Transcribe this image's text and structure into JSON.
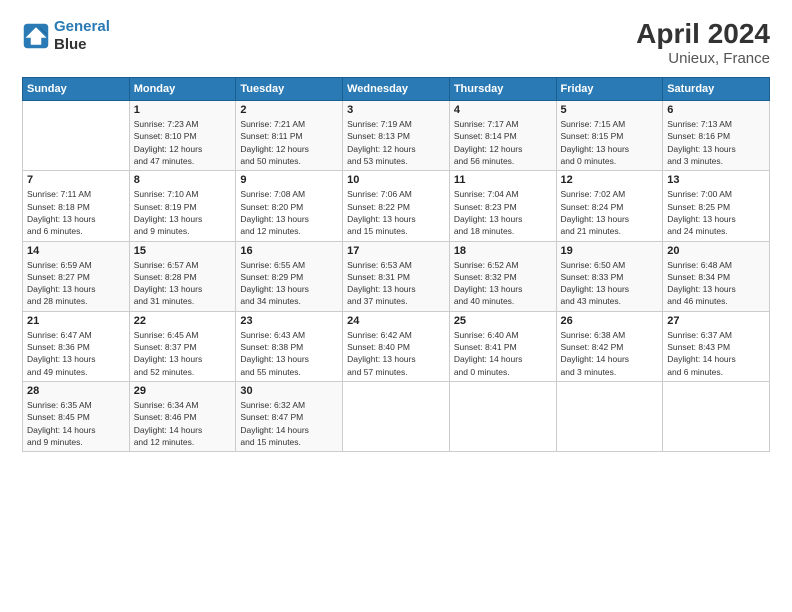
{
  "header": {
    "logo_line1": "General",
    "logo_line2": "Blue",
    "title": "April 2024",
    "subtitle": "Unieux, France"
  },
  "days_of_week": [
    "Sunday",
    "Monday",
    "Tuesday",
    "Wednesday",
    "Thursday",
    "Friday",
    "Saturday"
  ],
  "weeks": [
    [
      {
        "day": "",
        "info": ""
      },
      {
        "day": "1",
        "info": "Sunrise: 7:23 AM\nSunset: 8:10 PM\nDaylight: 12 hours\nand 47 minutes."
      },
      {
        "day": "2",
        "info": "Sunrise: 7:21 AM\nSunset: 8:11 PM\nDaylight: 12 hours\nand 50 minutes."
      },
      {
        "day": "3",
        "info": "Sunrise: 7:19 AM\nSunset: 8:13 PM\nDaylight: 12 hours\nand 53 minutes."
      },
      {
        "day": "4",
        "info": "Sunrise: 7:17 AM\nSunset: 8:14 PM\nDaylight: 12 hours\nand 56 minutes."
      },
      {
        "day": "5",
        "info": "Sunrise: 7:15 AM\nSunset: 8:15 PM\nDaylight: 13 hours\nand 0 minutes."
      },
      {
        "day": "6",
        "info": "Sunrise: 7:13 AM\nSunset: 8:16 PM\nDaylight: 13 hours\nand 3 minutes."
      }
    ],
    [
      {
        "day": "7",
        "info": "Sunrise: 7:11 AM\nSunset: 8:18 PM\nDaylight: 13 hours\nand 6 minutes."
      },
      {
        "day": "8",
        "info": "Sunrise: 7:10 AM\nSunset: 8:19 PM\nDaylight: 13 hours\nand 9 minutes."
      },
      {
        "day": "9",
        "info": "Sunrise: 7:08 AM\nSunset: 8:20 PM\nDaylight: 13 hours\nand 12 minutes."
      },
      {
        "day": "10",
        "info": "Sunrise: 7:06 AM\nSunset: 8:22 PM\nDaylight: 13 hours\nand 15 minutes."
      },
      {
        "day": "11",
        "info": "Sunrise: 7:04 AM\nSunset: 8:23 PM\nDaylight: 13 hours\nand 18 minutes."
      },
      {
        "day": "12",
        "info": "Sunrise: 7:02 AM\nSunset: 8:24 PM\nDaylight: 13 hours\nand 21 minutes."
      },
      {
        "day": "13",
        "info": "Sunrise: 7:00 AM\nSunset: 8:25 PM\nDaylight: 13 hours\nand 24 minutes."
      }
    ],
    [
      {
        "day": "14",
        "info": "Sunrise: 6:59 AM\nSunset: 8:27 PM\nDaylight: 13 hours\nand 28 minutes."
      },
      {
        "day": "15",
        "info": "Sunrise: 6:57 AM\nSunset: 8:28 PM\nDaylight: 13 hours\nand 31 minutes."
      },
      {
        "day": "16",
        "info": "Sunrise: 6:55 AM\nSunset: 8:29 PM\nDaylight: 13 hours\nand 34 minutes."
      },
      {
        "day": "17",
        "info": "Sunrise: 6:53 AM\nSunset: 8:31 PM\nDaylight: 13 hours\nand 37 minutes."
      },
      {
        "day": "18",
        "info": "Sunrise: 6:52 AM\nSunset: 8:32 PM\nDaylight: 13 hours\nand 40 minutes."
      },
      {
        "day": "19",
        "info": "Sunrise: 6:50 AM\nSunset: 8:33 PM\nDaylight: 13 hours\nand 43 minutes."
      },
      {
        "day": "20",
        "info": "Sunrise: 6:48 AM\nSunset: 8:34 PM\nDaylight: 13 hours\nand 46 minutes."
      }
    ],
    [
      {
        "day": "21",
        "info": "Sunrise: 6:47 AM\nSunset: 8:36 PM\nDaylight: 13 hours\nand 49 minutes."
      },
      {
        "day": "22",
        "info": "Sunrise: 6:45 AM\nSunset: 8:37 PM\nDaylight: 13 hours\nand 52 minutes."
      },
      {
        "day": "23",
        "info": "Sunrise: 6:43 AM\nSunset: 8:38 PM\nDaylight: 13 hours\nand 55 minutes."
      },
      {
        "day": "24",
        "info": "Sunrise: 6:42 AM\nSunset: 8:40 PM\nDaylight: 13 hours\nand 57 minutes."
      },
      {
        "day": "25",
        "info": "Sunrise: 6:40 AM\nSunset: 8:41 PM\nDaylight: 14 hours\nand 0 minutes."
      },
      {
        "day": "26",
        "info": "Sunrise: 6:38 AM\nSunset: 8:42 PM\nDaylight: 14 hours\nand 3 minutes."
      },
      {
        "day": "27",
        "info": "Sunrise: 6:37 AM\nSunset: 8:43 PM\nDaylight: 14 hours\nand 6 minutes."
      }
    ],
    [
      {
        "day": "28",
        "info": "Sunrise: 6:35 AM\nSunset: 8:45 PM\nDaylight: 14 hours\nand 9 minutes."
      },
      {
        "day": "29",
        "info": "Sunrise: 6:34 AM\nSunset: 8:46 PM\nDaylight: 14 hours\nand 12 minutes."
      },
      {
        "day": "30",
        "info": "Sunrise: 6:32 AM\nSunset: 8:47 PM\nDaylight: 14 hours\nand 15 minutes."
      },
      {
        "day": "",
        "info": ""
      },
      {
        "day": "",
        "info": ""
      },
      {
        "day": "",
        "info": ""
      },
      {
        "day": "",
        "info": ""
      }
    ]
  ]
}
